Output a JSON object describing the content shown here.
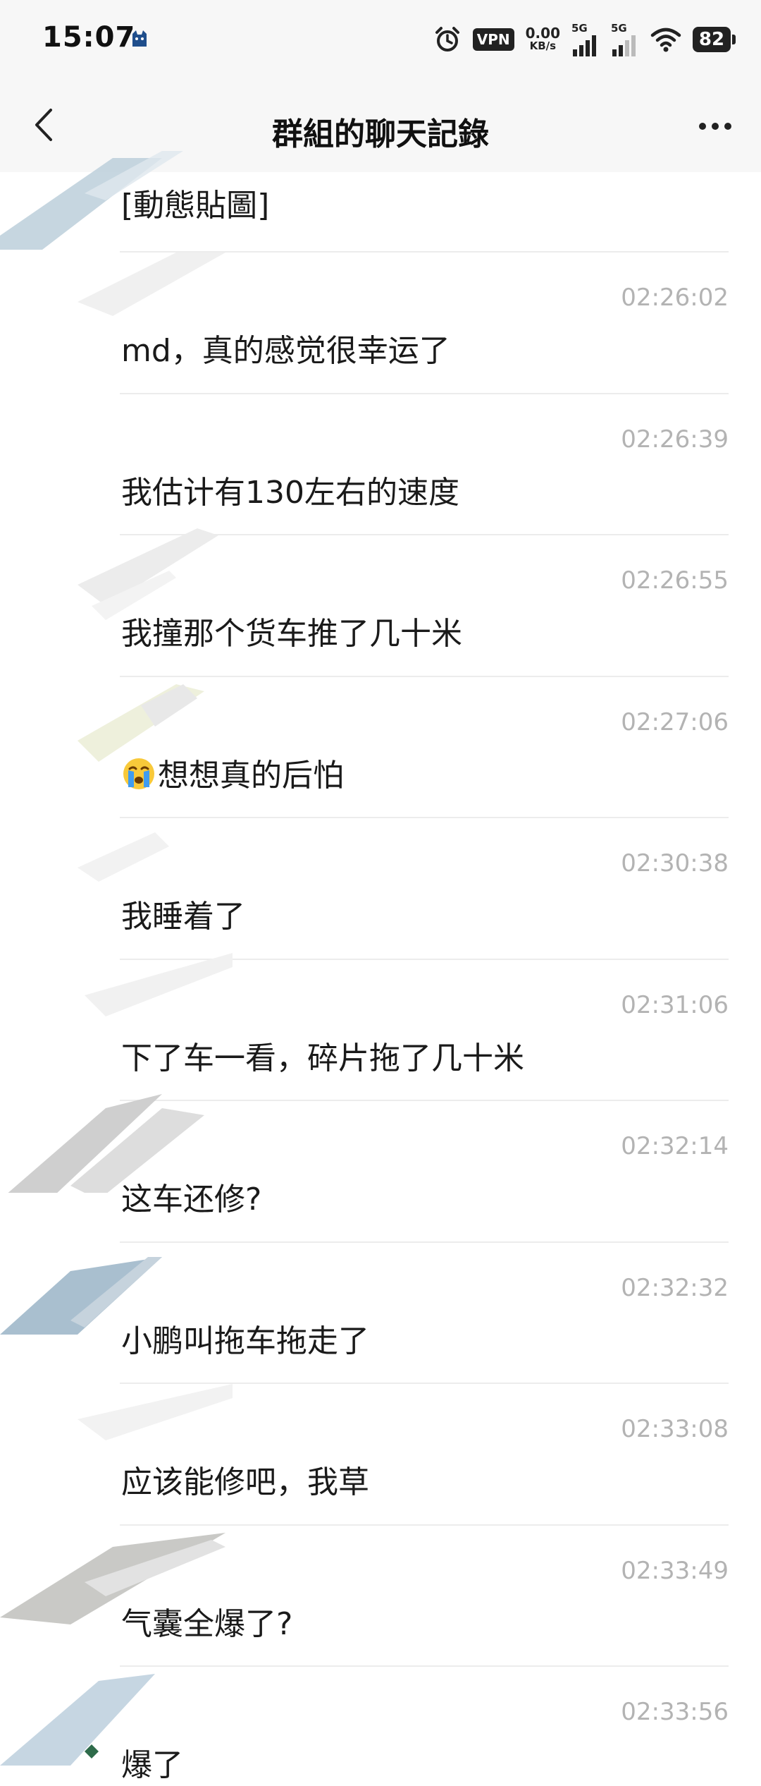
{
  "status_bar": {
    "time": "15:07",
    "vpn": "VPN",
    "net_speed": "0.00",
    "net_unit": "KB/s",
    "sim1": "5G",
    "sim2": "5G",
    "battery": "82",
    "icons": [
      "cat-icon",
      "alarm-icon",
      "signal-icon",
      "wifi-icon",
      "battery-icon"
    ]
  },
  "header": {
    "title": "群組的聊天記錄",
    "icons": [
      "back-arrow-icon",
      "more-options-icon"
    ]
  },
  "messages": [
    {
      "time": "",
      "text": "[動態貼圖]"
    },
    {
      "time": "02:26:02",
      "text": "md，真的感觉很幸运了"
    },
    {
      "time": "02:26:39",
      "text": "我估计有130左右的速度"
    },
    {
      "time": "02:26:55",
      "text": "我撞那个货车推了几十米"
    },
    {
      "time": "02:27:06",
      "emoji": "crying-face-emoji",
      "text": "想想真的后怕"
    },
    {
      "time": "02:30:38",
      "text": "我睡着了"
    },
    {
      "time": "02:31:06",
      "text": "下了车一看，碎片拖了几十米"
    },
    {
      "time": "02:32:14",
      "text": "这车还修?"
    },
    {
      "time": "02:32:32",
      "text": "小鹏叫拖车拖走了"
    },
    {
      "time": "02:33:08",
      "text": "应该能修吧，我草"
    },
    {
      "time": "02:33:49",
      "text": "气囊全爆了?"
    },
    {
      "time": "02:33:56",
      "text": "爆了"
    }
  ],
  "colors": {
    "background": "#ffffff",
    "bar_background": "#f7f7f7",
    "timestamp": "#b3b3b3",
    "divider": "#ececec"
  }
}
